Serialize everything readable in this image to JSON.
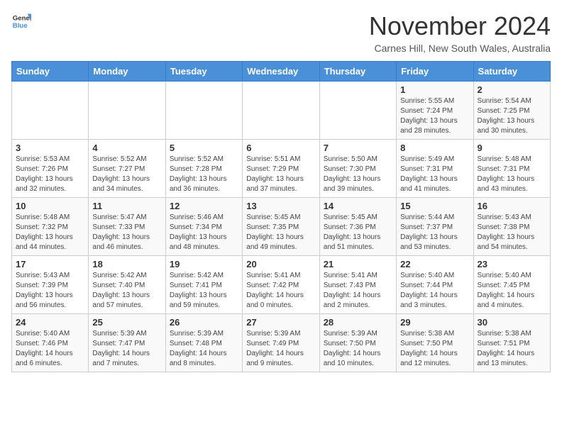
{
  "header": {
    "logo_general": "General",
    "logo_blue": "Blue",
    "month_title": "November 2024",
    "subtitle": "Carnes Hill, New South Wales, Australia"
  },
  "weekdays": [
    "Sunday",
    "Monday",
    "Tuesday",
    "Wednesday",
    "Thursday",
    "Friday",
    "Saturday"
  ],
  "weeks": [
    [
      {
        "day": "",
        "info": ""
      },
      {
        "day": "",
        "info": ""
      },
      {
        "day": "",
        "info": ""
      },
      {
        "day": "",
        "info": ""
      },
      {
        "day": "",
        "info": ""
      },
      {
        "day": "1",
        "info": "Sunrise: 5:55 AM\nSunset: 7:24 PM\nDaylight: 13 hours and 28 minutes."
      },
      {
        "day": "2",
        "info": "Sunrise: 5:54 AM\nSunset: 7:25 PM\nDaylight: 13 hours and 30 minutes."
      }
    ],
    [
      {
        "day": "3",
        "info": "Sunrise: 5:53 AM\nSunset: 7:26 PM\nDaylight: 13 hours and 32 minutes."
      },
      {
        "day": "4",
        "info": "Sunrise: 5:52 AM\nSunset: 7:27 PM\nDaylight: 13 hours and 34 minutes."
      },
      {
        "day": "5",
        "info": "Sunrise: 5:52 AM\nSunset: 7:28 PM\nDaylight: 13 hours and 36 minutes."
      },
      {
        "day": "6",
        "info": "Sunrise: 5:51 AM\nSunset: 7:29 PM\nDaylight: 13 hours and 37 minutes."
      },
      {
        "day": "7",
        "info": "Sunrise: 5:50 AM\nSunset: 7:30 PM\nDaylight: 13 hours and 39 minutes."
      },
      {
        "day": "8",
        "info": "Sunrise: 5:49 AM\nSunset: 7:31 PM\nDaylight: 13 hours and 41 minutes."
      },
      {
        "day": "9",
        "info": "Sunrise: 5:48 AM\nSunset: 7:31 PM\nDaylight: 13 hours and 43 minutes."
      }
    ],
    [
      {
        "day": "10",
        "info": "Sunrise: 5:48 AM\nSunset: 7:32 PM\nDaylight: 13 hours and 44 minutes."
      },
      {
        "day": "11",
        "info": "Sunrise: 5:47 AM\nSunset: 7:33 PM\nDaylight: 13 hours and 46 minutes."
      },
      {
        "day": "12",
        "info": "Sunrise: 5:46 AM\nSunset: 7:34 PM\nDaylight: 13 hours and 48 minutes."
      },
      {
        "day": "13",
        "info": "Sunrise: 5:45 AM\nSunset: 7:35 PM\nDaylight: 13 hours and 49 minutes."
      },
      {
        "day": "14",
        "info": "Sunrise: 5:45 AM\nSunset: 7:36 PM\nDaylight: 13 hours and 51 minutes."
      },
      {
        "day": "15",
        "info": "Sunrise: 5:44 AM\nSunset: 7:37 PM\nDaylight: 13 hours and 53 minutes."
      },
      {
        "day": "16",
        "info": "Sunrise: 5:43 AM\nSunset: 7:38 PM\nDaylight: 13 hours and 54 minutes."
      }
    ],
    [
      {
        "day": "17",
        "info": "Sunrise: 5:43 AM\nSunset: 7:39 PM\nDaylight: 13 hours and 56 minutes."
      },
      {
        "day": "18",
        "info": "Sunrise: 5:42 AM\nSunset: 7:40 PM\nDaylight: 13 hours and 57 minutes."
      },
      {
        "day": "19",
        "info": "Sunrise: 5:42 AM\nSunset: 7:41 PM\nDaylight: 13 hours and 59 minutes."
      },
      {
        "day": "20",
        "info": "Sunrise: 5:41 AM\nSunset: 7:42 PM\nDaylight: 14 hours and 0 minutes."
      },
      {
        "day": "21",
        "info": "Sunrise: 5:41 AM\nSunset: 7:43 PM\nDaylight: 14 hours and 2 minutes."
      },
      {
        "day": "22",
        "info": "Sunrise: 5:40 AM\nSunset: 7:44 PM\nDaylight: 14 hours and 3 minutes."
      },
      {
        "day": "23",
        "info": "Sunrise: 5:40 AM\nSunset: 7:45 PM\nDaylight: 14 hours and 4 minutes."
      }
    ],
    [
      {
        "day": "24",
        "info": "Sunrise: 5:40 AM\nSunset: 7:46 PM\nDaylight: 14 hours and 6 minutes."
      },
      {
        "day": "25",
        "info": "Sunrise: 5:39 AM\nSunset: 7:47 PM\nDaylight: 14 hours and 7 minutes."
      },
      {
        "day": "26",
        "info": "Sunrise: 5:39 AM\nSunset: 7:48 PM\nDaylight: 14 hours and 8 minutes."
      },
      {
        "day": "27",
        "info": "Sunrise: 5:39 AM\nSunset: 7:49 PM\nDaylight: 14 hours and 9 minutes."
      },
      {
        "day": "28",
        "info": "Sunrise: 5:39 AM\nSunset: 7:50 PM\nDaylight: 14 hours and 10 minutes."
      },
      {
        "day": "29",
        "info": "Sunrise: 5:38 AM\nSunset: 7:50 PM\nDaylight: 14 hours and 12 minutes."
      },
      {
        "day": "30",
        "info": "Sunrise: 5:38 AM\nSunset: 7:51 PM\nDaylight: 14 hours and 13 minutes."
      }
    ]
  ]
}
